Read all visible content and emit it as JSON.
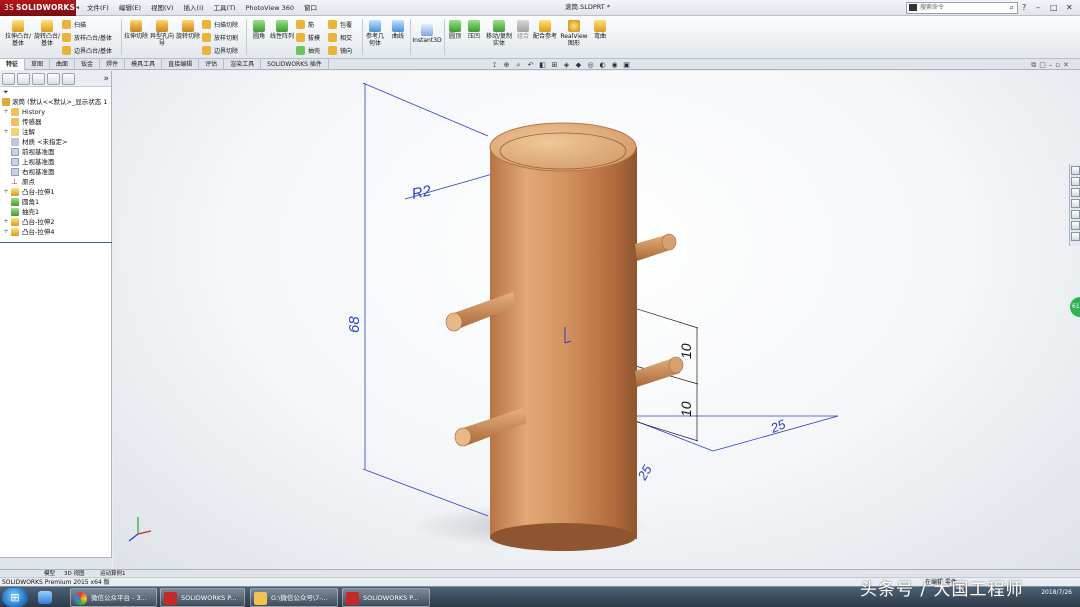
{
  "titlebar": {
    "logo_ds": "3S",
    "logo": "SOLIDWORKS",
    "menus": [
      "文件(F)",
      "编辑(E)",
      "视图(V)",
      "插入(I)",
      "工具(T)",
      "PhotoView 360",
      "窗口"
    ],
    "document_title": "滚筒.SLDPRT *",
    "search_placeholder": "搜索命令"
  },
  "commands": {
    "extrude_boss": "拉伸凸台/基体",
    "revolve_boss": "旋转凸台/基体",
    "sweep": "扫描",
    "loft": "放样凸台/基体",
    "boundary_boss": "边界凸台/基体",
    "extrude_cut": "拉伸切除",
    "hole_wizard": "异型孔向导",
    "revolve_cut": "旋转切除",
    "swept_cut": "扫描切除",
    "lofted_cut": "放样切割",
    "boundary_cut": "边界切除",
    "fillet": "圆角",
    "linear_pattern": "线性阵列",
    "rib": "筋",
    "draft": "拔模",
    "shell": "抽壳",
    "wrap": "包覆",
    "intersect": "相交",
    "mirror": "镜向",
    "ref_geometry": "参考几何体",
    "curves": "曲线",
    "instant3d": "Instant3D",
    "dome": "圆顶",
    "indent": "压凹",
    "move_copy": "移动/复制实体",
    "combine": "组合",
    "mate_ref": "配合参考",
    "realview": "RealView 图形",
    "electrical": "弯曲"
  },
  "tabs": [
    "特征",
    "草图",
    "曲面",
    "钣金",
    "焊件",
    "模具工具",
    "直接编辑",
    "评估",
    "渲染工具",
    "SOLIDWORKS 插件"
  ],
  "tree": {
    "root": "滚筒 (默认<<默认>_显示状态 1",
    "items": [
      "History",
      "传感器",
      "注解",
      "材质 <未指定>",
      "前视基准面",
      "上视基准面",
      "右视基准面",
      "原点",
      "凸台-拉伸1",
      "圆角1",
      "抽壳1",
      "凸台-拉伸2",
      "凸台-拉伸4"
    ]
  },
  "dimensions": {
    "radius": "R2",
    "height": "68",
    "pin_spacing_1": "10",
    "pin_spacing_2": "10",
    "width": "25",
    "depth": "25"
  },
  "bottom_tabs": [
    "模型",
    "3D 视图",
    "运动算例1"
  ],
  "status_text": "SOLIDWORKS Premium 2015 x64 版",
  "status_right": "在编辑 零件",
  "taskbar": {
    "items": [
      "微信公众平台 - 3...",
      "SOLIDWORKS P...",
      "G:\\微信公众号\\7-...",
      "SOLIDWORKS P..."
    ],
    "time": "",
    "date": "2018/7/26"
  },
  "watermark": "头条号 / 大国工程师",
  "colors": {
    "accent_red": "#b3171c",
    "dimension_blue": "#2b3fc8",
    "wood": "#c8895a"
  }
}
